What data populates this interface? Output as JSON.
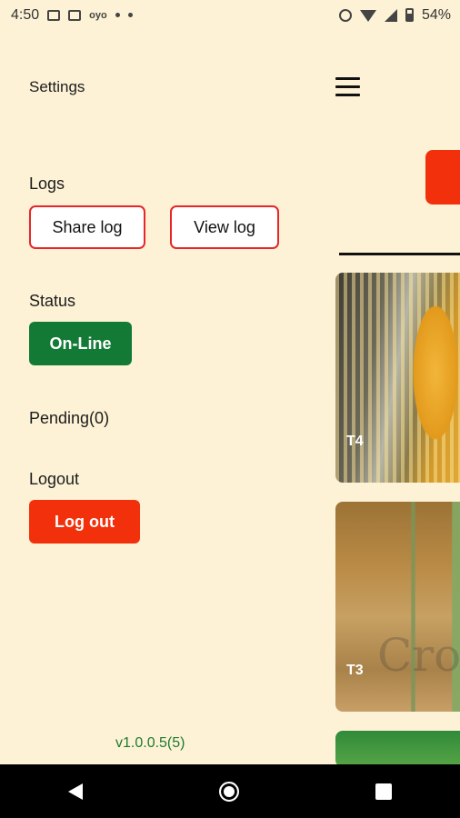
{
  "status_bar": {
    "time": "4:50",
    "battery": "54%",
    "left_icons": [
      "image-icon",
      "news-icon",
      "oyo-icon",
      "dots-icon",
      "dot-icon"
    ],
    "right_icons": [
      "alarm-icon",
      "wifi-icon",
      "signal-icon",
      "battery-icon"
    ],
    "oyo_text": "oyo"
  },
  "drawer": {
    "title": "Settings",
    "logs": {
      "label": "Logs",
      "share_label": "Share log",
      "view_label": "View log"
    },
    "status": {
      "label": "Status",
      "button_label": "On-Line",
      "color": "#137a36"
    },
    "pending": "Pending(0)",
    "logout": {
      "label": "Logout",
      "button_label": "Log out",
      "color": "#f2300b"
    },
    "version": "v1.0.0.5(5)"
  },
  "main": {
    "menu_icon": "hamburger-icon",
    "cards": [
      {
        "label": "T4",
        "image": "corn"
      },
      {
        "label": "T3",
        "image": "wheat"
      },
      {
        "label": "",
        "image": "green-field"
      }
    ],
    "watermark": "Cro"
  },
  "nav_bar": {
    "icons": [
      "back-icon",
      "home-icon",
      "recents-icon"
    ]
  },
  "colors": {
    "background": "#fdf2d6",
    "accent_red": "#e8262a",
    "online_green": "#137a36",
    "logout_red": "#f2300b"
  }
}
